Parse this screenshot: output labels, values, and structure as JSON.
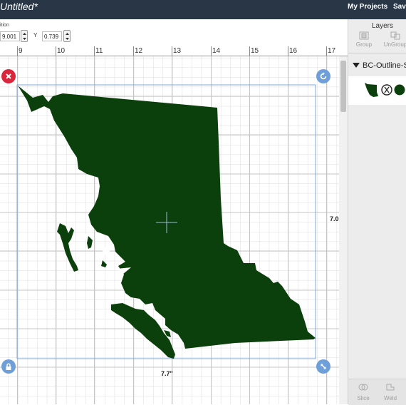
{
  "header": {
    "title": "Untitled*",
    "my_projects": "My Projects",
    "save": "Save"
  },
  "toolbar": {
    "position_label": "ition",
    "x_value": "9.001",
    "y_label": "Y",
    "y_value": "0.739"
  },
  "ruler": {
    "ticks": [
      "9",
      "10",
      "11",
      "12",
      "13",
      "14",
      "15",
      "16",
      "17"
    ]
  },
  "selection": {
    "width_label": "7.7\"",
    "height_label": "7.0"
  },
  "layers_panel": {
    "title": "Layers",
    "group_label": "Group",
    "ungroup_label": "UnGroup",
    "layer_name": "BC-Outline-S",
    "slice_label": "Slice",
    "weld_label": "Weld"
  },
  "colors": {
    "shape_fill": "#0b3f0b",
    "topbar": "#283646",
    "selection_border": "#7ea7d8",
    "delete_handle": "#d9263c",
    "handle_blue": "#6e9fd8"
  },
  "icons": {
    "delete": "close-icon",
    "rotate": "rotate-icon",
    "lock": "lock-icon",
    "resize": "resize-icon",
    "collapse": "triangle-down-icon"
  }
}
